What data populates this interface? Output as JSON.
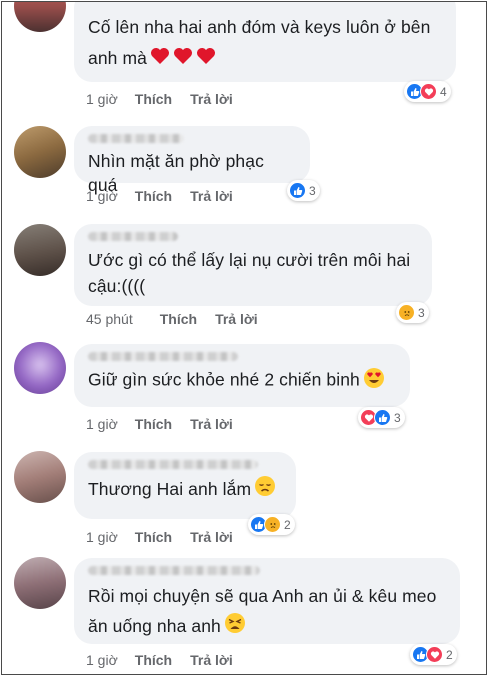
{
  "comments": [
    {
      "text": "Cố lên nha hai anh đóm và keys luôn ở bên\nanh mà",
      "time": "1 giờ",
      "like": "Thích",
      "reply": "Trả lời",
      "reactions": [
        "like",
        "love"
      ],
      "react_count": "4",
      "trailing_emoji": [
        "heart",
        "heart",
        "heart"
      ]
    },
    {
      "text": "Nhìn mặt ăn phờ phạc quá",
      "time": "1 giờ",
      "like": "Thích",
      "reply": "Trả lời",
      "reactions": [
        "like"
      ],
      "react_count": "3"
    },
    {
      "text": "Ước gì có thể lấy lại nụ cười trên môi hai\ncậu:((((",
      "time": "45 phút",
      "like": "Thích",
      "reply": "Trả lời",
      "reactions": [
        "sad"
      ],
      "react_count": "3"
    },
    {
      "text": "Giữ gìn sức khỏe nhé 2 chiến binh",
      "time": "1 giờ",
      "like": "Thích",
      "reply": "Trả lời",
      "reactions": [
        "love",
        "like"
      ],
      "react_count": "3",
      "trailing_emoji": [
        "heart-eyes"
      ]
    },
    {
      "text": "Thương Hai anh lắm",
      "time": "1 giờ",
      "like": "Thích",
      "reply": "Trả lời",
      "reactions": [
        "like",
        "sad"
      ],
      "react_count": "2",
      "trailing_emoji": [
        "disappointed-face"
      ]
    },
    {
      "text": "Rồi mọi chuyện sẽ qua Anh an ủi & kêu meo\năn uống nha anh",
      "time": "1 giờ",
      "like": "Thích",
      "reply": "Trả lời",
      "reactions": [
        "like",
        "love"
      ],
      "react_count": "2",
      "trailing_emoji": [
        "tired-face"
      ]
    }
  ],
  "colors": {
    "bubble": "#f0f2f5",
    "text": "#1c1e21",
    "meta": "#65676b",
    "like": "#1877f2",
    "love": "#f33e58",
    "sad": "#f7b125"
  }
}
